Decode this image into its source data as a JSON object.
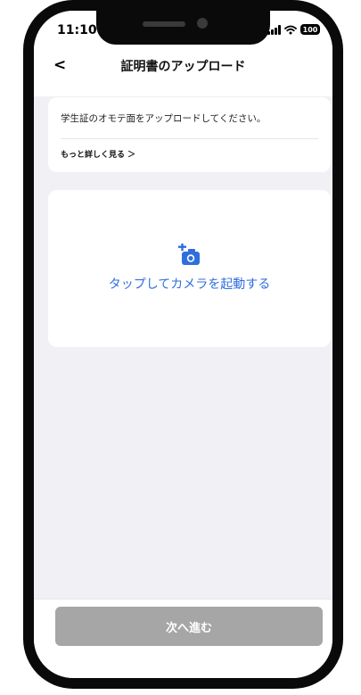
{
  "status_bar": {
    "time": "11:10",
    "battery": "100"
  },
  "header": {
    "back_label": "<",
    "title": "証明書のアップロード"
  },
  "info_card": {
    "instruction": "学生証のオモテ面をアップロードしてください。",
    "more_link": "もっと詳しく見る ＞"
  },
  "camera_card": {
    "icon": "add-camera-icon",
    "label": "タップしてカメラを起動する"
  },
  "footer": {
    "next_button": "次へ進む"
  },
  "colors": {
    "accent_blue": "#2f6fdc",
    "disabled_button": "#a6a6a6",
    "background": "#f1f1f5"
  }
}
